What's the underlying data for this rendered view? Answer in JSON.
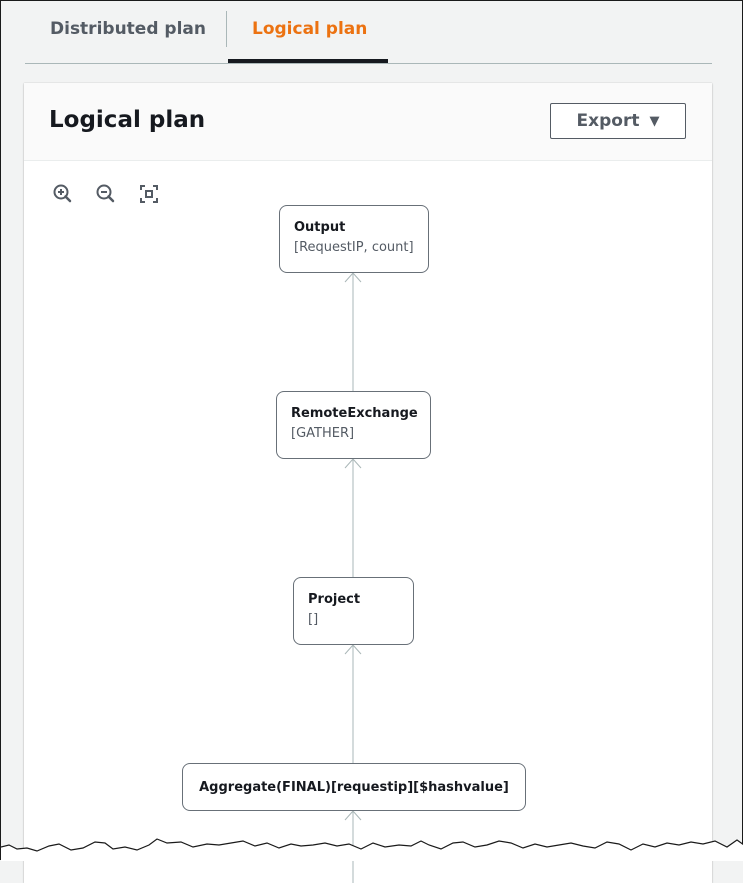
{
  "tabs": [
    {
      "label": "Distributed plan",
      "active": false
    },
    {
      "label": "Logical plan",
      "active": true
    }
  ],
  "panel": {
    "title": "Logical plan",
    "export_label": "Export",
    "export_caret": "▼"
  },
  "toolbar": {
    "zoom_in": "zoom-in-icon",
    "zoom_out": "zoom-out-icon",
    "fit": "fit-to-screen-icon"
  },
  "colors": {
    "accent": "#ec7211",
    "text_dark": "#16191f",
    "text_muted": "#545b64",
    "edge": "#aab7b8"
  },
  "nodes": [
    {
      "title": "Output",
      "detail": "[RequestIP, count]"
    },
    {
      "title": "RemoteExchange",
      "detail": "[GATHER]"
    },
    {
      "title": "Project",
      "detail": "[]"
    },
    {
      "title": "Aggregate(FINAL)[requestip][$hashvalue]",
      "detail": ""
    }
  ]
}
